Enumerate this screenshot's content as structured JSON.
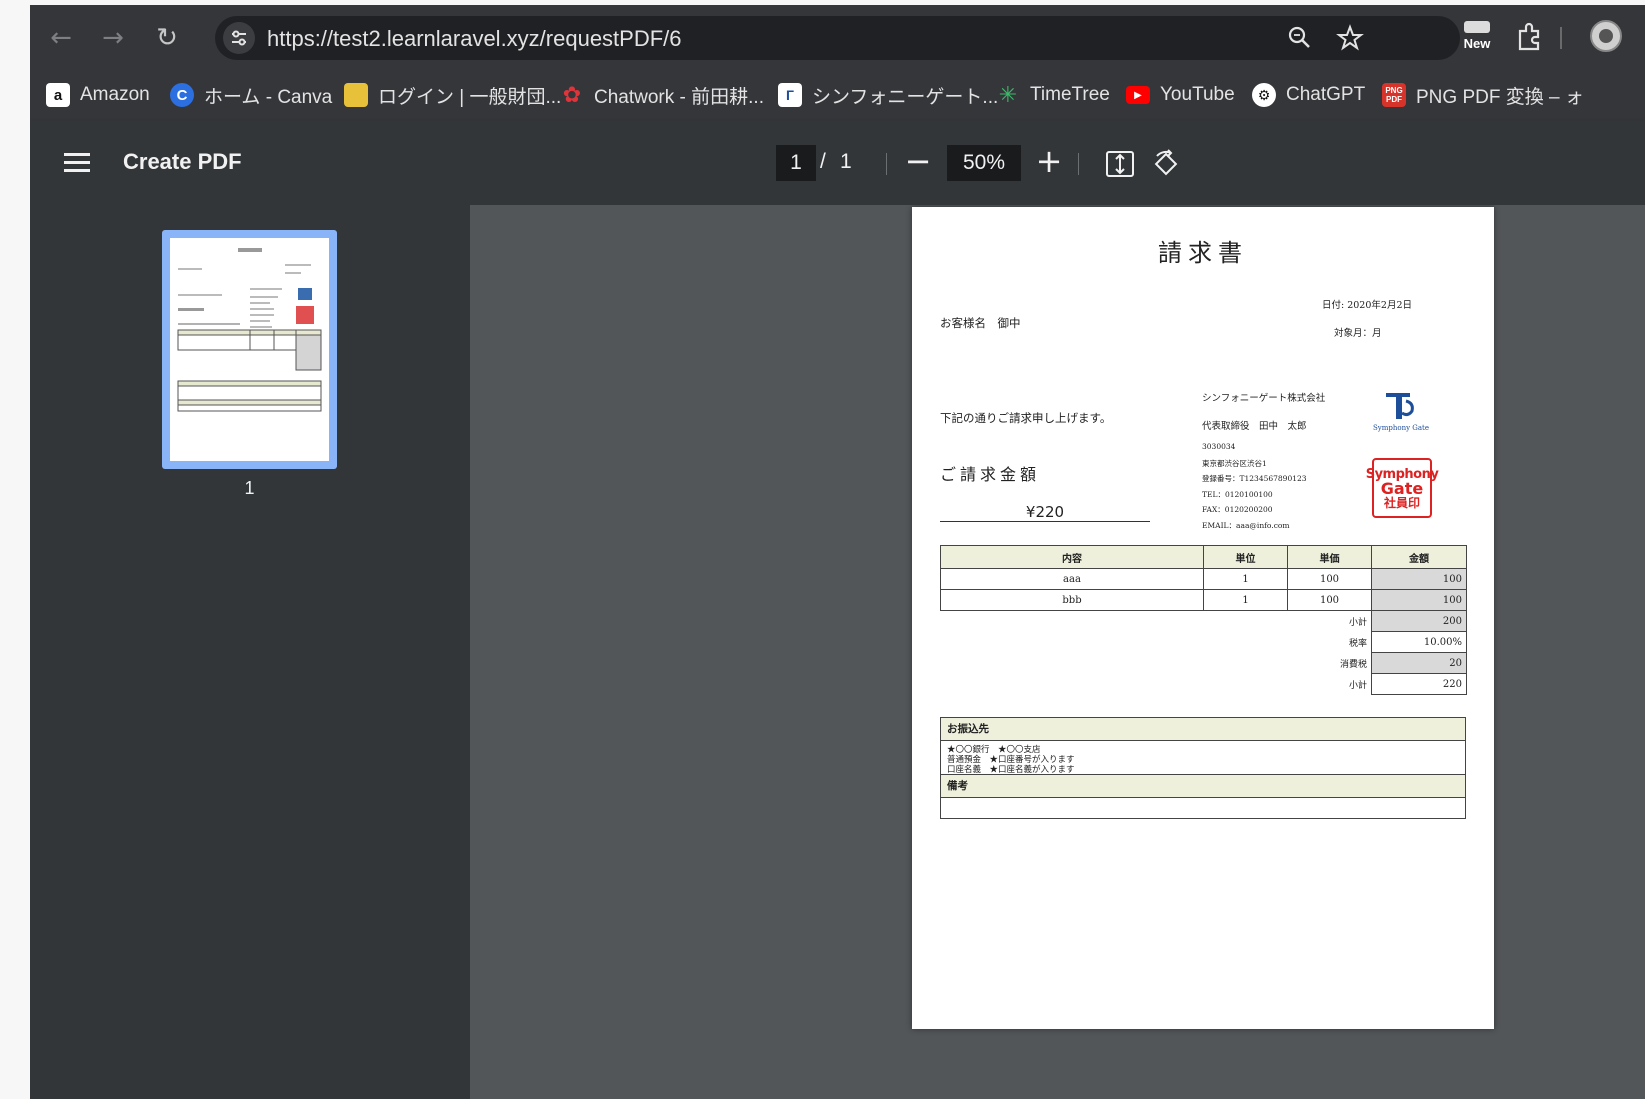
{
  "browser": {
    "url": "https://test2.learnlaravel.xyz/requestPDF/6",
    "new_badge": "New"
  },
  "bookmarks": [
    {
      "label": "Amazon",
      "icon": "amazon-icon",
      "color": "#111111"
    },
    {
      "label": "ホーム - Canva",
      "icon": "canva-icon",
      "color": "#2b6fe0"
    },
    {
      "label": "ログイン | 一般財団...",
      "icon": "login-site-icon",
      "color": "#e8c13a"
    },
    {
      "label": "Chatwork - 前田耕...",
      "icon": "chatwork-icon",
      "color": "#e0343b"
    },
    {
      "label": "シンフォニーゲート...",
      "icon": "symphony-gate-icon",
      "color": "#ffffff"
    },
    {
      "label": "TimeTree",
      "icon": "timetree-icon",
      "color": "#3cb96a"
    },
    {
      "label": "YouTube",
      "icon": "youtube-icon",
      "color": "#ff0000"
    },
    {
      "label": "ChatGPT",
      "icon": "chatgpt-icon",
      "color": "#ffffff"
    },
    {
      "label": "PNG PDF 変換 – ォ",
      "icon": "png-pdf-icon",
      "color": "#d6332b"
    }
  ],
  "pdf_toolbar": {
    "title": "Create PDF",
    "current_page": "1",
    "separator": "/",
    "total_pages": "1",
    "zoom": "50%",
    "zoom_out": "−",
    "zoom_in": "+"
  },
  "sidebar": {
    "thumbnail_number": "1"
  },
  "invoice": {
    "title": "請求書",
    "date": "日付: 2020年2月2日",
    "target_month": "対象月：月",
    "customer": "お客様名　御中",
    "intro": "下記の通りご請求申し上げます。",
    "amount_label": "ご請求金額",
    "amount_value": "¥220",
    "company": "シンフォニーゲート株式会社",
    "representative": "代表取締役　田中　太郎",
    "postal": "3030034",
    "address": "東京都渋谷区渋谷1",
    "registration": "登録番号：T1234567890123",
    "tel": "TEL：0120100100",
    "fax": "FAX：0120200200",
    "email": "EMAIL：aaa@info.com",
    "logo_text": "Symphony Gate",
    "seal_line1": "Symphony",
    "seal_line2": "Gate",
    "seal_line3": "社員印",
    "headers": [
      "内容",
      "単位",
      "単価",
      "金額"
    ],
    "rows": [
      {
        "item": "aaa",
        "unit": "1",
        "price": "100",
        "amount": "100"
      },
      {
        "item": "bbb",
        "unit": "1",
        "price": "100",
        "amount": "100"
      }
    ],
    "subtotal_label": "小計",
    "subtotal": "200",
    "tax_rate_label": "税率",
    "tax_rate": "10.00%",
    "tax_label": "消費税",
    "tax": "20",
    "total_label": "小計",
    "total": "220",
    "bank_header": "お振込先",
    "bank_line1": "★〇〇銀行　★〇〇支店",
    "bank_line2": "普通預金　★口座番号が入ります",
    "bank_line3": "口座名義　★口座名義が入ります",
    "notes_header": "備考"
  }
}
